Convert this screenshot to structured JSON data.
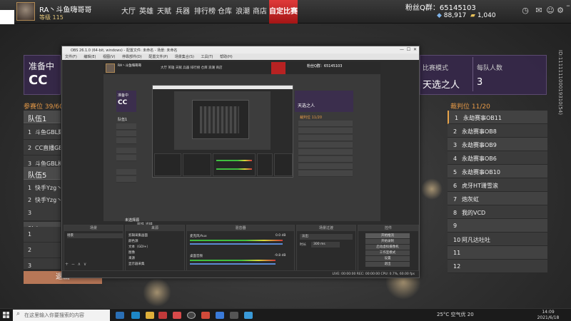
{
  "topbar": {
    "player_name": "RA丶斗鱼嗨哥哥",
    "player_level": "等级 115",
    "tabs": [
      "大厅",
      "英雄",
      "天赋",
      "兵器",
      "排行榜",
      "仓库",
      "浪潮",
      "商店",
      "自定比赛"
    ],
    "active_tab": "自定比赛",
    "fans_label": "粉丝Q群：",
    "fans_group": "65145103",
    "currency_a": "88,917",
    "currency_b": "1,040",
    "icons": [
      "clock-icon",
      "mail-icon",
      "friends-icon",
      "settings-icon",
      "minimize-icon",
      "close-icon"
    ]
  },
  "lobby": {
    "prep_text": "准备中",
    "title": "CC",
    "mode_label": "比赛模式",
    "mode_value": "天选之人",
    "size_label": "每队人数",
    "size_value": "3",
    "slots_label": "参赛位 39/60",
    "judges_label": "裁判位 11/20",
    "teams": [
      {
        "name": "队伍1",
        "rows": [
          {
            "num": "1",
            "player": "斗鱼GBL鹰"
          },
          {
            "num": "2",
            "player": "CC直播GBL"
          },
          {
            "num": "3",
            "player": "斗鱼GBL梅"
          }
        ]
      },
      {
        "name": "队伍5",
        "rows": [
          {
            "num": "1",
            "player": "快手Yzg丶h"
          },
          {
            "num": "2",
            "player": "快手Yzg丶h"
          },
          {
            "num": "3",
            "player": ""
          }
        ]
      },
      {
        "name": "队伍9",
        "rows": [
          {
            "num": "1",
            "player": ""
          },
          {
            "num": "2",
            "player": ""
          },
          {
            "num": "3",
            "player": ""
          }
        ]
      }
    ],
    "judges": [
      {
        "num": "1",
        "name": "永劫赛事OB11"
      },
      {
        "num": "2",
        "name": "永劫赛事OB8"
      },
      {
        "num": "3",
        "name": "永劫赛事OB9"
      },
      {
        "num": "4",
        "name": "永劫赛事OB6"
      },
      {
        "num": "5",
        "name": "永劫赛事OB10"
      },
      {
        "num": "6",
        "name": "虎牙HT珊雪滚"
      },
      {
        "num": "7",
        "name": "炮灰虹"
      },
      {
        "num": "8",
        "name": "我的VCD"
      },
      {
        "num": "9",
        "name": ""
      },
      {
        "num": "10",
        "name": "阿凡达吐吐"
      },
      {
        "num": "11",
        "name": ""
      },
      {
        "num": "12",
        "name": ""
      }
    ],
    "exit_label": "退出",
    "vertical_id": "ID:111111100019310(54)"
  },
  "obs": {
    "title": "OBS 26.1.0 (64-bit, windows) - 配置文件: 未命名 - 场景: 未命名",
    "menu": [
      "文件(F)",
      "编辑(E)",
      "视图(V)",
      "停靠部件(D)",
      "配置文件(P)",
      "场景集合(S)",
      "工具(T)",
      "帮助(H)"
    ],
    "preview_top": {
      "name": "RA丶斗鱼嗨哥哥",
      "tabs": "大厅  英雄  天赋  兵器  排行榜  仓库  浪潮  商店",
      "fans": "粉丝Q群：65145103",
      "cc": "CC",
      "prep": "准备中",
      "mode": "天选之人",
      "judges": "裁判位 11/20",
      "team": "队伍1"
    },
    "scene_active": "未选择源",
    "scene_tabs": "属性   滤镜",
    "docks": {
      "scenes": "场景",
      "sources": "来源",
      "mixer": "混音器",
      "transitions": "场景过渡",
      "controls": "控件"
    },
    "scene_item": "场景",
    "sources": [
      "剪辑采集画面",
      "颜色源",
      "文本（GDI+）",
      "图像",
      "来源",
      "显示器采集"
    ],
    "mixer": [
      {
        "label": "麦克风/Aux",
        "db": "0.0 dB"
      },
      {
        "label": "桌面音频",
        "db": "-9.8 dB"
      }
    ],
    "transition_value": "淡出",
    "transition_duration_label": "时长",
    "transition_duration": "300 ms",
    "controls": [
      "开始推流",
      "开始录制",
      "启动虚拟摄像机",
      "工作室模式",
      "设置",
      "退出"
    ],
    "status": "LIVE: 00:00:00   REC: 00:00:00   CPU: 0.7%, 60.00 fps"
  },
  "taskbar": {
    "search_placeholder": "在这里输入你要搜索的内容",
    "tray_text": "25°C 空气优 20",
    "time": "14:09",
    "date": "2021/6/18"
  },
  "colors": {
    "accent_red": "#b82222",
    "lobby_purple": "#37284b",
    "orange": "#e79a47"
  }
}
